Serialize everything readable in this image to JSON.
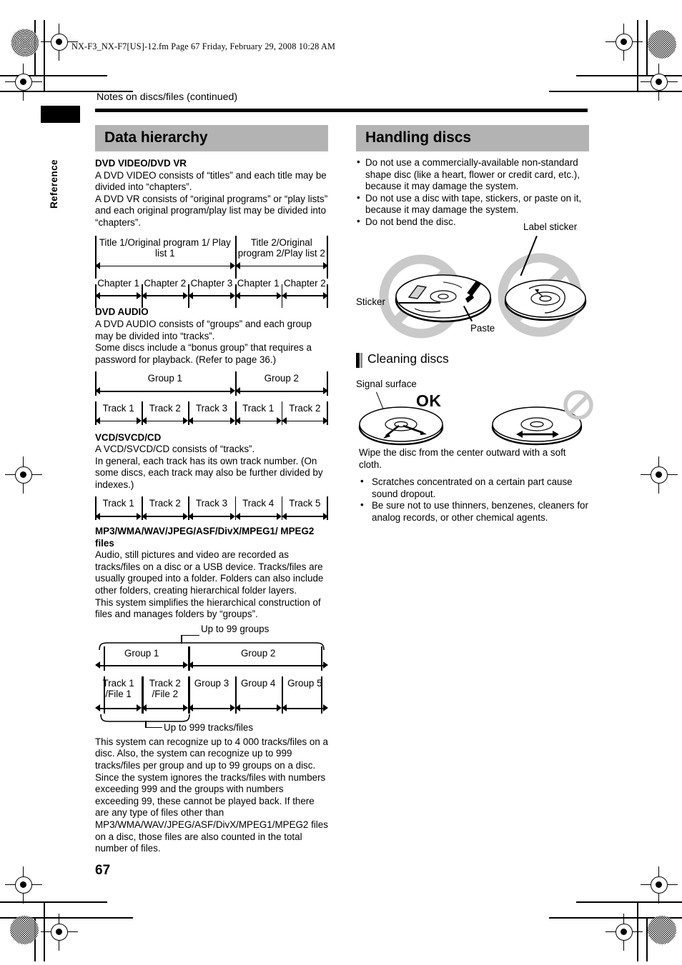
{
  "meta": {
    "file_header": "NX-F3_NX-F7[US]-12.fm  Page 67  Friday, February 29, 2008  10:28 AM",
    "page_number": "67",
    "side_tab_label": "Reference",
    "running_head": "Notes on discs/files (continued)"
  },
  "left_column": {
    "section_title": "Data hierarchy",
    "blocks": [
      {
        "heading": "DVD VIDEO/DVD VR",
        "paragraphs": [
          "A DVD VIDEO consists of “titles” and each title may be divided into “chapters”.",
          "A DVD VR consists of “original programs” or “play lists” and each original program/play list may be divided into “chapters”."
        ]
      },
      {
        "heading": "DVD AUDIO",
        "paragraphs": [
          "A DVD AUDIO consists of “groups” and each group may be divided into “tracks”.",
          "Some discs include a “bonus group” that requires a password for playback. (Refer to page 36.)"
        ]
      },
      {
        "heading": "VCD/SVCD/CD",
        "paragraphs": [
          "A VCD/SVCD/CD consists of “tracks”.",
          "In general, each track has its own track number. (On some discs, each track may also be further divided by indexes.)"
        ]
      },
      {
        "heading": "MP3/WMA/WAV/JPEG/ASF/DivX/MPEG1/ MPEG2 files",
        "paragraphs": [
          "Audio, still pictures and video are recorded as tracks/files on a disc or a USB device. Tracks/files are usually grouped into a folder. Folders can also include other folders, creating hierarchical folder layers.",
          "This system simplifies the hierarchical construction of files and manages folders by “groups”."
        ]
      }
    ],
    "closing_paragraph": "This system can recognize up to 4 000 tracks/files on a disc. Also, the system can recognize up to 999 tracks/files per group and up to 99 groups on a disc. Since the system ignores the tracks/files with numbers exceeding 999 and the groups with numbers exceeding 99, these cannot be played back. If there are any type of files other than MP3/WMA/WAV/JPEG/ASF/DivX/MPEG1/MPEG2 files on a disc, those files are also counted in the total number of files.",
    "diagrams": {
      "dvd_video": {
        "top_row": [
          {
            "label": "Title 1/Original program 1/ Play list 1",
            "span": 3
          },
          {
            "label": "Title 2/Original program 2/Play list 2",
            "span": 2
          }
        ],
        "bottom_row": [
          "Chapter 1",
          "Chapter 2",
          "Chapter 3",
          "Chapter 1",
          "Chapter 2"
        ]
      },
      "dvd_audio": {
        "top_row": [
          {
            "label": "Group 1",
            "span": 3
          },
          {
            "label": "Group 2",
            "span": 2
          }
        ],
        "bottom_row": [
          "Track 1",
          "Track 2",
          "Track 3",
          "Track 1",
          "Track 2"
        ]
      },
      "vcd": {
        "row": [
          "Track 1",
          "Track 2",
          "Track 3",
          "Track 4",
          "Track 5"
        ]
      },
      "mp3": {
        "note_top": "Up to 99 groups",
        "note_bottom": "Up to 999 tracks/files",
        "top_row": [
          {
            "label": "Group 1",
            "span": 2
          },
          {
            "label": "Group 2",
            "span": 3
          }
        ],
        "bottom_row": [
          "Track 1 /File 1",
          "Track 2 /File 2",
          "Group 3",
          "Group 4",
          "Group 5"
        ]
      }
    }
  },
  "right_column": {
    "section_title": "Handling discs",
    "handling_bullets": [
      "Do not use a commercially-available non-standard shape disc (like a heart, flower or credit card, etc.), because it may damage the system.",
      "Do not use a disc with tape, stickers, or paste on it, because it may damage the system.",
      "Do not bend the disc."
    ],
    "handling_illustration": {
      "label_sticker": "Label sticker",
      "sticker": "Sticker",
      "paste": "Paste"
    },
    "cleaning_title": "Cleaning discs",
    "cleaning_illustration": {
      "signal_surface": "Signal surface",
      "ok_mark": "OK"
    },
    "cleaning_text": "Wipe the disc from the center outward with a soft cloth.",
    "cleaning_bullets": [
      "Scratches concentrated on a certain part cause sound dropout.",
      "Be sure not to use thinners, benzenes, cleaners for analog records, or other chemical agents."
    ]
  },
  "colors": {
    "section_band": "#b3b3b3",
    "prohibition_gray": "#c9c9c9",
    "rule_black": "#000000"
  }
}
